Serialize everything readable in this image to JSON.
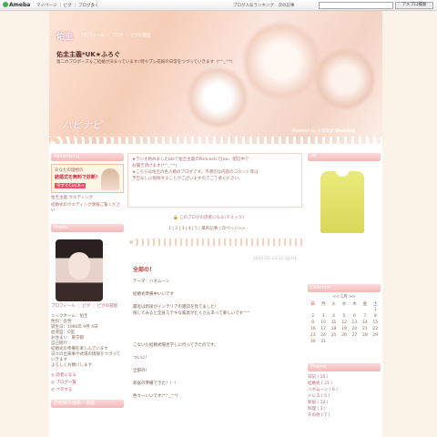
{
  "topbar": {
    "logo": "Ameba",
    "links": "マイページ ｜ ピグ ｜ ブログ多く",
    "ad": "ブログ人気ランキング　次の記事",
    "ad2": "ブログを書く",
    "search_button": "アメブロ検索"
  },
  "header": {
    "name": "佑圭",
    "links": "プロフィール ｜ ブログ ｜ ピグの部屋",
    "blog_title": "佑圭主義*UK★ふろぐ",
    "blog_desc": "第二のプロポーズ＆ご結婚が決まっています♪時々プレ花嫁の日常をつづっていきます（*^_^*）",
    "happy": "ハピナピ",
    "powered_prefix": "Powered by",
    "powered_brand": "ぐるなび Wedding"
  },
  "notice": {
    "lines": [
      "★ラジオ始めましたbloで佑圭主義のPodcastsでJew、配信中で",
      "お聞き頂けます(*^_^*)",
      "★こちらは佑圭の各人婚のブログです。不適切な内容のコメント等は",
      "予告なしに削除することがございますのでご了承ください。"
    ]
  },
  "center_link": "このブログの読者になる(チェック)",
  "pager": "1 | 2 | 3 | 4 | 5 | 最新記事 | 次ページ>>",
  "entry": {
    "date": "2011-01-23 11:52:01",
    "title": "全部の！",
    "lines": [
      "テーマ：ハネムーン",
      "",
      "結婚式準備中いいです",
      "",
      "最近は新居がインテリアの雑誌を見てました！",
      "探してみると全身ステキな家具がたくさんあって楽しいです^^",
      "",
      "",
      "",
      "",
      "こないだ結婚式場見学しに行ってきたのです。",
      "",
      "ついに！",
      "",
      "全部の！",
      "",
      "新居の準備できた！！！",
      "",
      "色々ーいいです(*^_^*)"
    ]
  },
  "left": {
    "adv_header": "Advertising",
    "adv_t1": "あなたの理想の",
    "adv_t2": "結婚式を無料で診断！",
    "adv_t3": "今すぐCLICK→",
    "adv_sub1": "佑圭主義 ウエディング",
    "adv_sub2": "結婚式のウエディング情報ご覧ください",
    "profile_header": "Profile",
    "profile_links": "プロフィール ｜ ピグ ｜ ピグの部屋",
    "info": [
      "ニックネーム：佑圭",
      "性別：女性",
      "誕生日：1986年 9月 4日",
      "血液型：O型",
      "お住まい：東京都",
      "自己紹介：",
      "結婚式の準備を楽しんでいます",
      "日々の出来事や式場の情報をつづっていきます",
      "よろしくお願いします"
    ],
    "l1": "読者になる",
    "l2": "ブログ一覧",
    "l3": "ペタする",
    "left_sub": "読者様の画像・動画"
  },
  "right": {
    "pr_header": "PR",
    "cal_header": "Calendar",
    "month": "<< 1月 >>",
    "days": [
      "日",
      "月",
      "火",
      "水",
      "木",
      "金",
      "土"
    ],
    "weeks": [
      [
        "",
        "",
        "",
        "",
        "",
        "",
        "1"
      ],
      [
        "2",
        "3",
        "4",
        "5",
        "6",
        "7",
        "8"
      ],
      [
        "9",
        "10",
        "11",
        "12",
        "13",
        "14",
        "15"
      ],
      [
        "16",
        "17",
        "18",
        "19",
        "20",
        "21",
        "22"
      ],
      [
        "23",
        "24",
        "25",
        "26",
        "27",
        "28",
        "29"
      ],
      [
        "30",
        "31",
        "",
        "",
        "",
        "",
        ""
      ]
    ],
    "theme_header": "Theme",
    "themes": [
      "日記 ( 10 )",
      "結婚式 ( 21 )",
      "ハネムーン ( 6 )",
      "ドレス ( 5 )",
      "新居 ( 12 )",
      "料理 ( 3 )",
      "その他 ( 7 )"
    ]
  },
  "colors": {
    "accent": "#f4b9b9",
    "link": "#c06070",
    "bg": "#fbf3e8"
  }
}
